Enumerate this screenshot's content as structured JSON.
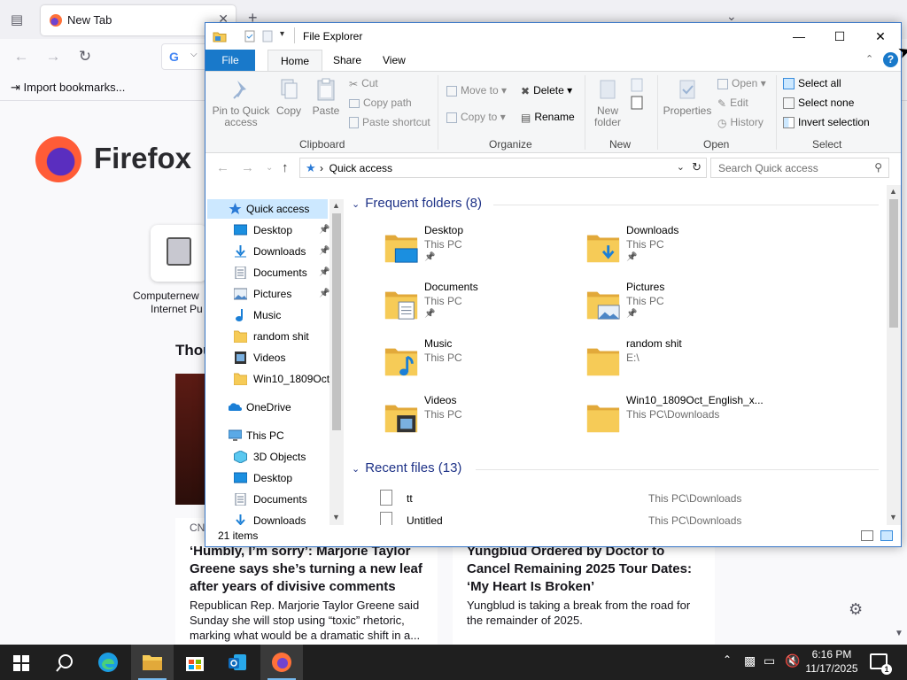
{
  "firefox": {
    "tab_title": "New Tab",
    "bookmark_import": "Import bookmarks...",
    "logo_text": "Firefox",
    "shortcut_label_line1": "Computernew",
    "shortcut_label_line2": "Internet Pu",
    "section_heading": "Thou",
    "cards": [
      {
        "source": "CN",
        "title": "‘Humbly, I’m sorry’: Marjorie Taylor Greene says she’s turning a new leaf after years of divisive comments",
        "desc": "Republican Rep. Marjorie Taylor Greene said Sunday she will stop using “toxic” rhetoric, marking what would be a dramatic shift in a..."
      },
      {
        "source": "",
        "title": "Yungblud Ordered by Doctor to Cancel Remaining 2025 Tour Dates: ‘My Heart Is Broken’",
        "desc": "Yungblud is taking a break from the road for the remainder of 2025."
      }
    ]
  },
  "explorer": {
    "title": "File Explorer",
    "tabs": {
      "file": "File",
      "home": "Home",
      "share": "Share",
      "view": "View"
    },
    "ribbon": {
      "clipboard": {
        "label": "Clipboard",
        "pin": "Pin to Quick access",
        "copy": "Copy",
        "paste": "Paste",
        "cut": "Cut",
        "copy_path": "Copy path",
        "paste_shortcut": "Paste shortcut"
      },
      "organize": {
        "label": "Organize",
        "move_to": "Move to",
        "copy_to": "Copy to",
        "delete": "Delete",
        "rename": "Rename"
      },
      "new": {
        "label": "New",
        "new_folder": "New folder"
      },
      "open": {
        "label": "Open",
        "properties": "Properties",
        "open": "Open",
        "edit": "Edit",
        "history": "History"
      },
      "select": {
        "label": "Select",
        "select_all": "Select all",
        "select_none": "Select none",
        "invert": "Invert selection"
      }
    },
    "address": {
      "path": "Quick access",
      "search_placeholder": "Search Quick access"
    },
    "nav": [
      {
        "label": "Quick access",
        "icon": "star-icon",
        "pinned": false,
        "selected": true
      },
      {
        "label": "Desktop",
        "icon": "desktop-icon",
        "pinned": true
      },
      {
        "label": "Downloads",
        "icon": "downloads-icon",
        "pinned": true
      },
      {
        "label": "Documents",
        "icon": "documents-icon",
        "pinned": true
      },
      {
        "label": "Pictures",
        "icon": "pictures-icon",
        "pinned": true
      },
      {
        "label": "Music",
        "icon": "music-icon",
        "pinned": false
      },
      {
        "label": "random shit",
        "icon": "folder-icon",
        "pinned": false
      },
      {
        "label": "Videos",
        "icon": "videos-icon",
        "pinned": false
      },
      {
        "label": "Win10_1809Oct_",
        "icon": "folder-icon",
        "pinned": false
      },
      {
        "label": "OneDrive",
        "icon": "onedrive-icon",
        "pinned": false
      },
      {
        "label": "This PC",
        "icon": "this-pc-icon",
        "pinned": false
      },
      {
        "label": "3D Objects",
        "icon": "3d-objects-icon",
        "pinned": false
      },
      {
        "label": "Desktop",
        "icon": "desktop-icon",
        "pinned": false
      },
      {
        "label": "Documents",
        "icon": "documents-icon",
        "pinned": false
      },
      {
        "label": "Downloads",
        "icon": "downloads-icon",
        "pinned": false
      }
    ],
    "frequent_header": "Frequent folders (8)",
    "frequent": [
      {
        "name": "Desktop",
        "location": "This PC",
        "pinned": true,
        "icon": "desktop"
      },
      {
        "name": "Downloads",
        "location": "This PC",
        "pinned": true,
        "icon": "downloads"
      },
      {
        "name": "Documents",
        "location": "This PC",
        "pinned": true,
        "icon": "documents"
      },
      {
        "name": "Pictures",
        "location": "This PC",
        "pinned": true,
        "icon": "pictures"
      },
      {
        "name": "Music",
        "location": "This PC",
        "pinned": false,
        "icon": "music"
      },
      {
        "name": "random shit",
        "location": "E:\\",
        "pinned": false,
        "icon": "plain"
      },
      {
        "name": "Videos",
        "location": "This PC",
        "pinned": false,
        "icon": "videos"
      },
      {
        "name": "Win10_1809Oct_English_x...",
        "location": "This PC\\Downloads",
        "pinned": false,
        "icon": "plain"
      }
    ],
    "recent_header": "Recent files (13)",
    "recent": [
      {
        "name": "tt",
        "location": "This PC\\Downloads"
      },
      {
        "name": "Untitled",
        "location": "This PC\\Downloads"
      }
    ],
    "status": "21 items"
  },
  "taskbar": {
    "time": "6:16 PM",
    "date": "11/17/2025",
    "notifications": "1"
  },
  "colors": {
    "accent": "#1979ca",
    "folder": "#f6cb57",
    "selection": "#cce8ff",
    "group_header": "#1e3287"
  }
}
